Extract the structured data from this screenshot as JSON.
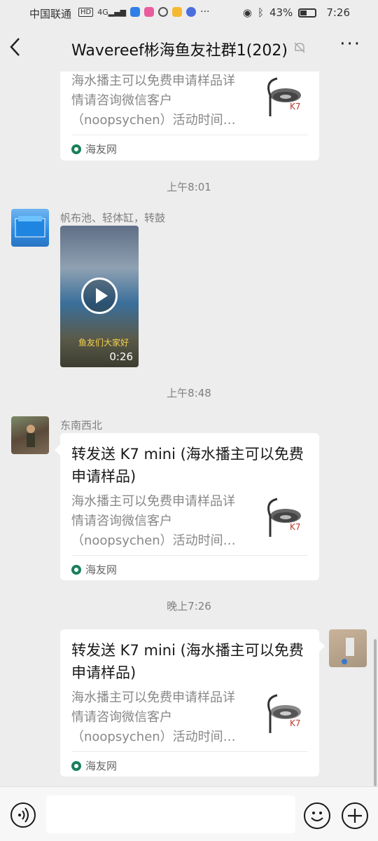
{
  "status_bar": {
    "carrier": "中国联通",
    "battery": "43%",
    "time": "7:26"
  },
  "nav": {
    "title": "Wavereef彬海鱼友社群1(202)",
    "back_icon": "chevron-left-icon",
    "more_icon": "more-dots-icon",
    "mute_icon": "bell-muted-icon"
  },
  "messages": {
    "msg0": {
      "desc": "海水播主可以免费申请样品详情请咨询微信客户（noopsychen）活动时间…",
      "source": "海友网"
    },
    "time1": "上午8:01",
    "msg1": {
      "sender": "帆布池、轻体缸，转鼓",
      "video_duration": "0:26",
      "video_caption": "鱼友们大家好"
    },
    "time2": "上午8:48",
    "msg2": {
      "sender": "东南西北",
      "title": "转发送 K7 mini (海水播主可以免费申请样品)",
      "desc": "海水播主可以免费申请样品详情请咨询微信客户（noopsychen）活动时间…",
      "source": "海友网"
    },
    "time3": "晚上7:26",
    "msg3": {
      "title": "转发送 K7 mini (海水播主可以免费申请样品)",
      "desc": "海水播主可以免费申请样品详情请咨询微信客户（noopsychen）活动时间…",
      "source": "海友网"
    }
  },
  "input": {
    "voice_icon": "voice-icon",
    "emoji_icon": "emoji-icon",
    "plus_icon": "plus-icon"
  }
}
